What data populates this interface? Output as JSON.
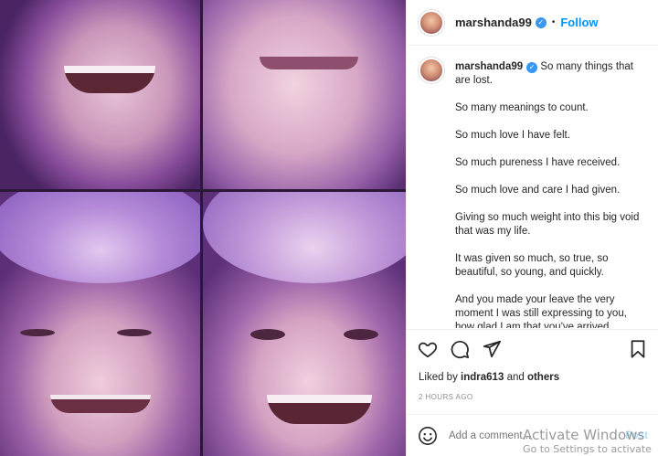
{
  "post": {
    "username": "marshanda99",
    "verified_badge": "✓",
    "separator": "•",
    "follow_label": "Follow"
  },
  "caption": {
    "username": "marshanda99",
    "verified_badge": "✓",
    "lines": [
      "So many things that are lost.",
      "So many meanings to count.",
      "So much love I have felt.",
      "So much pureness I have received.",
      "So much love and care I had given.",
      "Giving so much weight into this big void that was my life.",
      "It was given so much, so true, so beautiful, so young, and quickly.",
      "And you made your leave the very moment I was still expressing to you, how glad I am that you've arrived."
    ]
  },
  "actions": {
    "icons": [
      "heart-icon",
      "comment-icon",
      "share-icon",
      "bookmark-icon"
    ]
  },
  "likes": {
    "prefix": "Liked by",
    "user": "indra613",
    "conjunction": "and",
    "others": "others"
  },
  "timestamp": "2 HOURS AGO",
  "comment": {
    "placeholder": "Add a comment...",
    "post_label": "Post"
  },
  "watermark": {
    "line1": "Activate Windows",
    "line2": "Go to Settings to activate Windows."
  },
  "colors": {
    "accent": "#0095f6",
    "post_disabled": "#b2dffc",
    "muted": "#8e8e8e"
  }
}
